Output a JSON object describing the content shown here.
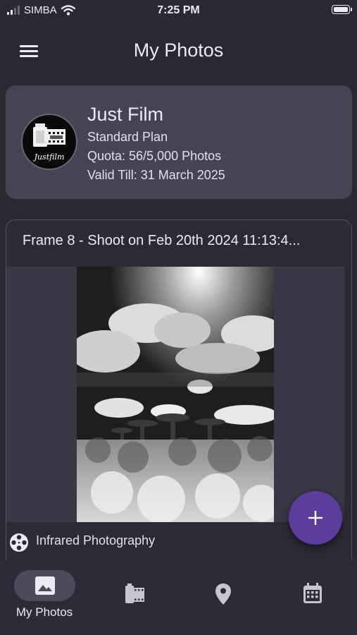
{
  "status_bar": {
    "carrier": "SIMBA",
    "time": "7:25 PM"
  },
  "app_bar": {
    "title": "My Photos"
  },
  "account": {
    "logo_text": "Justfilm",
    "name": "Just Film",
    "plan": "Standard Plan",
    "quota": "Quota: 56/5,000 Photos",
    "valid_till": "Valid Till: 31 March 2025"
  },
  "photo_card": {
    "title": "Frame 8 - Shoot on Feb 20th 2024 11:13:4...",
    "tag": "Infrared Photography"
  },
  "fab": {
    "icon": "plus-icon"
  },
  "bottom_nav": {
    "items": [
      {
        "label": "My Photos",
        "icon": "image-icon",
        "active": true
      },
      {
        "icon": "film-roll-icon"
      },
      {
        "icon": "location-pin-icon"
      },
      {
        "icon": "calendar-icon"
      }
    ]
  },
  "colors": {
    "background": "#2a2830",
    "card": "#464355",
    "accent": "#5c3d9e",
    "active_pill": "#4e4a5c"
  }
}
